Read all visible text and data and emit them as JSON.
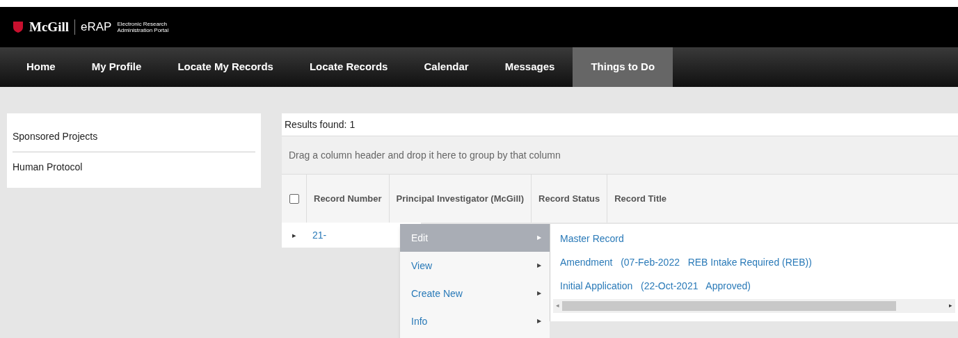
{
  "brand": {
    "name": "McGill",
    "product": "eRAP",
    "tagline": "Electronic Research Administration Portal"
  },
  "nav": [
    {
      "label": "Home",
      "selected": false
    },
    {
      "label": "My Profile",
      "selected": false
    },
    {
      "label": "Locate My Records",
      "selected": false
    },
    {
      "label": "Locate Records",
      "selected": false
    },
    {
      "label": "Calendar",
      "selected": false
    },
    {
      "label": "Messages",
      "selected": false
    },
    {
      "label": "Things to Do",
      "selected": true
    }
  ],
  "sidebar": {
    "items": [
      "Sponsored Projects",
      "Human Protocol"
    ]
  },
  "results": {
    "count_label": "Results found: 1",
    "group_hint": "Drag a column header and drop it here to group by that column",
    "columns": [
      "Record Number",
      "Principal Investigator (McGill)",
      "Record Status",
      "Record Title"
    ],
    "select_all": {
      "checked": false
    },
    "rows": [
      {
        "expander": "▸",
        "record_number": "21-"
      }
    ]
  },
  "context_menu": {
    "items": [
      {
        "label": "Edit",
        "arrow": "▶",
        "selected": true
      },
      {
        "label": "View",
        "arrow": "▶",
        "selected": false
      },
      {
        "label": "Create New",
        "arrow": "▶",
        "selected": false
      },
      {
        "label": "Info",
        "arrow": "▶",
        "selected": false
      }
    ]
  },
  "submenu": {
    "items": [
      {
        "name": "Master Record"
      },
      {
        "name": "Amendment",
        "detail": "(07-Feb-2022   REB Intake Required (REB))"
      },
      {
        "name": "Initial Application",
        "detail": "(22-Oct-2021   Approved)"
      }
    ],
    "scroll_left": "◂",
    "scroll_right": "▸"
  }
}
